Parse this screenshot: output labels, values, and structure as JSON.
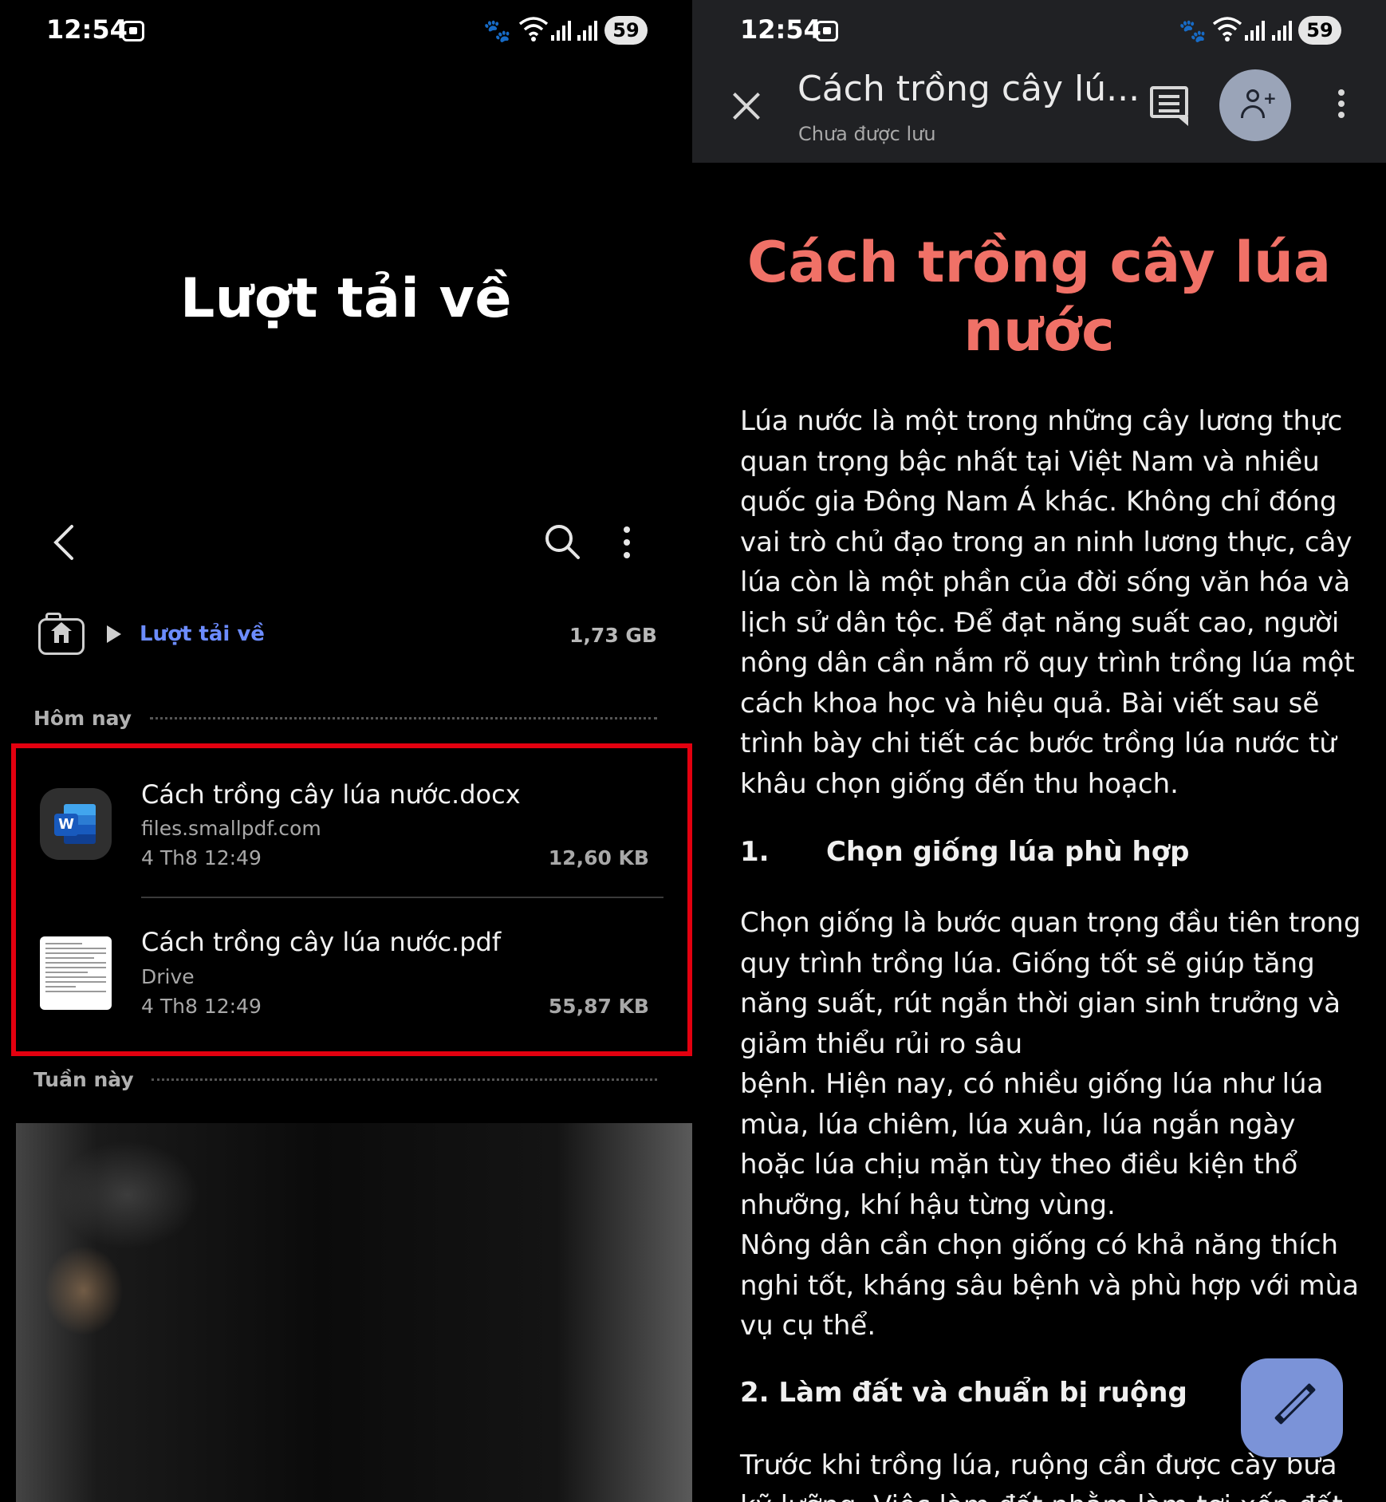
{
  "status_bar": {
    "time": "12:54",
    "battery": "59"
  },
  "downloads": {
    "title": "Lượt tải về",
    "breadcrumb": "Lượt tải về",
    "storage": "1,73 GB",
    "sections": {
      "today": "Hôm nay",
      "this_week": "Tuần này"
    },
    "files": [
      {
        "name": "Cách trồng cây lúa nước.docx",
        "source": "files.smallpdf.com",
        "date": "4 Th8 12:49",
        "size": "12,60 KB",
        "icon": "word-icon"
      },
      {
        "name": "Cách trồng cây lúa nước.pdf",
        "source": "Drive",
        "date": "4 Th8 12:49",
        "size": "55,87 KB",
        "icon": "pdf-thumbnail-icon"
      }
    ]
  },
  "document": {
    "app_title": "Cách trồng cây lú...",
    "save_status": "Chưa được lưu",
    "heading": "Cách trồng cây lúa nước",
    "intro": "Lúa nước là một trong những cây lương thực quan trọng bậc nhất tại Việt Nam và nhiều quốc gia Đông Nam Á khác. Không chỉ đóng vai trò chủ đạo trong an ninh lương thực, cây lúa còn là một phần của đời sống văn hóa và lịch sử dân tộc. Để đạt năng suất cao, người nông dân cần nắm rõ quy trình trồng lúa một cách khoa học và hiệu quả. Bài viết sau sẽ trình bày chi tiết các bước trồng lúa nước từ khâu chọn giống đến thu hoạch.",
    "section1_number": "1.",
    "section1_title": "Chọn giống lúa phù hợp",
    "section1_p1": "Chọn giống là bước quan trọng đầu tiên trong quy trình trồng lúa. Giống tốt sẽ giúp tăng năng suất, rút ngắn thời gian sinh trưởng và giảm thiểu rủi ro sâu",
    "section1_p2": "bệnh. Hiện nay, có nhiều giống lúa như lúa mùa, lúa chiêm, lúa xuân, lúa ngắn ngày hoặc lúa chịu mặn tùy theo điều kiện thổ nhưỡng, khí hậu từng vùng.",
    "section1_p3": "Nông dân cần chọn giống có khả năng thích nghi tốt, kháng sâu bệnh và phù hợp với mùa vụ cụ thể.",
    "section2_title": "2. Làm đất và chuẩn bị ruộng",
    "section2_p1": "Trước khi trồng lúa, ruộng cần được cày bừa kỹ lưỡng. Việc làm đất nhằm làm tơi xốp đất"
  },
  "colors": {
    "accent_link": "#6c8cff",
    "highlight": "#e3000f",
    "doc_heading": "#f07167",
    "fab": "#7b93d8"
  }
}
